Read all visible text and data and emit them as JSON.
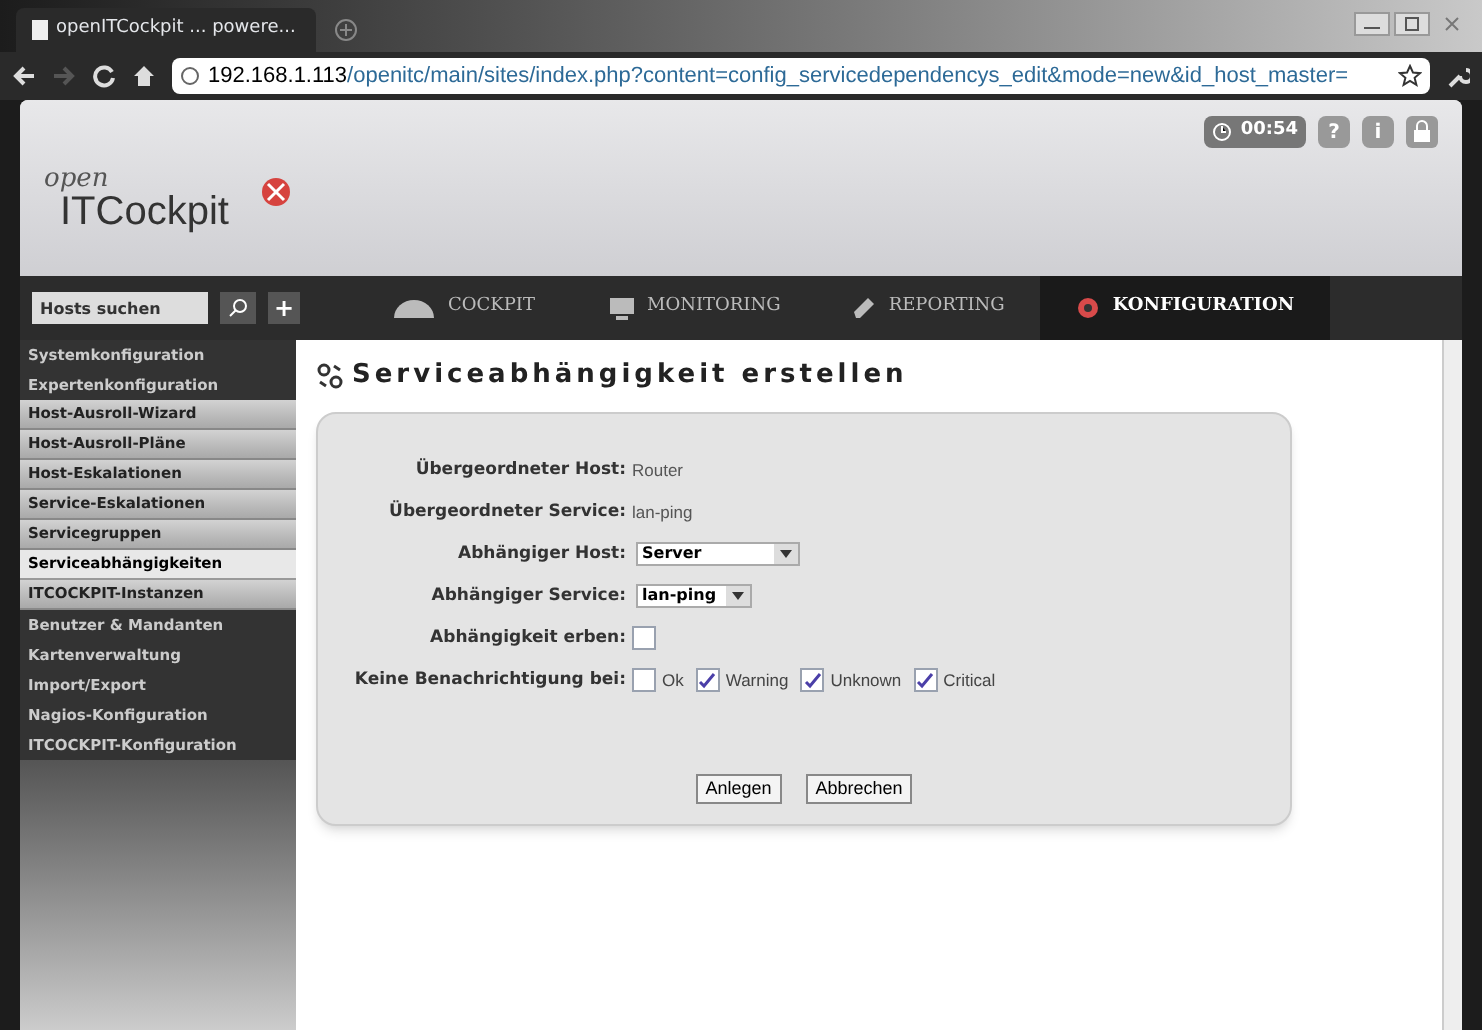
{
  "browser": {
    "tab_title": "openITCockpit ... powere...",
    "url_host": "192.168.1.113",
    "url_path": "/openitc/main/sites/index.php?content=config_servicedependencys_edit&mode=new&id_host_master="
  },
  "header": {
    "logo_small": "open",
    "logo_big": "ITCockpit",
    "timer": "00:54",
    "help": "?",
    "info": "i"
  },
  "search": {
    "placeholder": "Hosts suchen",
    "add": "+"
  },
  "nav": [
    {
      "label": "COCKPIT",
      "selected": false
    },
    {
      "label": "MONITORING",
      "selected": false
    },
    {
      "label": "REPORTING",
      "selected": false
    },
    {
      "label": "KONFIGURATION",
      "selected": true
    }
  ],
  "sidebar": {
    "items": [
      {
        "label": "Systemkonfiguration",
        "kind": "group",
        "selected": false
      },
      {
        "label": "Expertenkonfiguration",
        "kind": "group",
        "selected": false
      },
      {
        "label": "Host-Ausroll-Wizard",
        "kind": "sub",
        "selected": false
      },
      {
        "label": "Host-Ausroll-Pläne",
        "kind": "sub",
        "selected": false
      },
      {
        "label": "Host-Eskalationen",
        "kind": "sub",
        "selected": false
      },
      {
        "label": "Service-Eskalationen",
        "kind": "sub",
        "selected": false
      },
      {
        "label": "Servicegruppen",
        "kind": "sub",
        "selected": false
      },
      {
        "label": "Serviceabhängigkeiten",
        "kind": "sub",
        "selected": true
      },
      {
        "label": "ITCOCKPIT-Instanzen",
        "kind": "sub",
        "selected": false
      },
      {
        "label": "Benutzer & Mandanten",
        "kind": "group",
        "selected": false
      },
      {
        "label": "Kartenverwaltung",
        "kind": "group",
        "selected": false
      },
      {
        "label": "Import/Export",
        "kind": "group",
        "selected": false
      },
      {
        "label": "Nagios-Konfiguration",
        "kind": "group",
        "selected": false
      },
      {
        "label": "ITCOCKPIT-Konfiguration",
        "kind": "group",
        "selected": false
      }
    ]
  },
  "page_title": "Serviceabhängigkeit erstellen",
  "form": {
    "rows": [
      {
        "label": "Übergeordneter Host:",
        "kind": "text",
        "value": "Router"
      },
      {
        "label": "Übergeordneter Service:",
        "kind": "text",
        "value": "lan-ping"
      },
      {
        "label": "Abhängiger Host:",
        "kind": "select",
        "value": "Server"
      },
      {
        "label": "Abhängiger Service:",
        "kind": "select",
        "value": "lan-ping"
      },
      {
        "label": "Abhängigkeit erben:",
        "kind": "checkbox",
        "checked": false
      },
      {
        "label": "Keine Benachrichtigung bei:",
        "kind": "checks",
        "options": [
          {
            "label": "Ok",
            "checked": false
          },
          {
            "label": "Warning",
            "checked": true
          },
          {
            "label": "Unknown",
            "checked": true
          },
          {
            "label": "Critical",
            "checked": true
          }
        ]
      }
    ],
    "buttons": [
      "Anlegen",
      "Abbrechen"
    ]
  }
}
